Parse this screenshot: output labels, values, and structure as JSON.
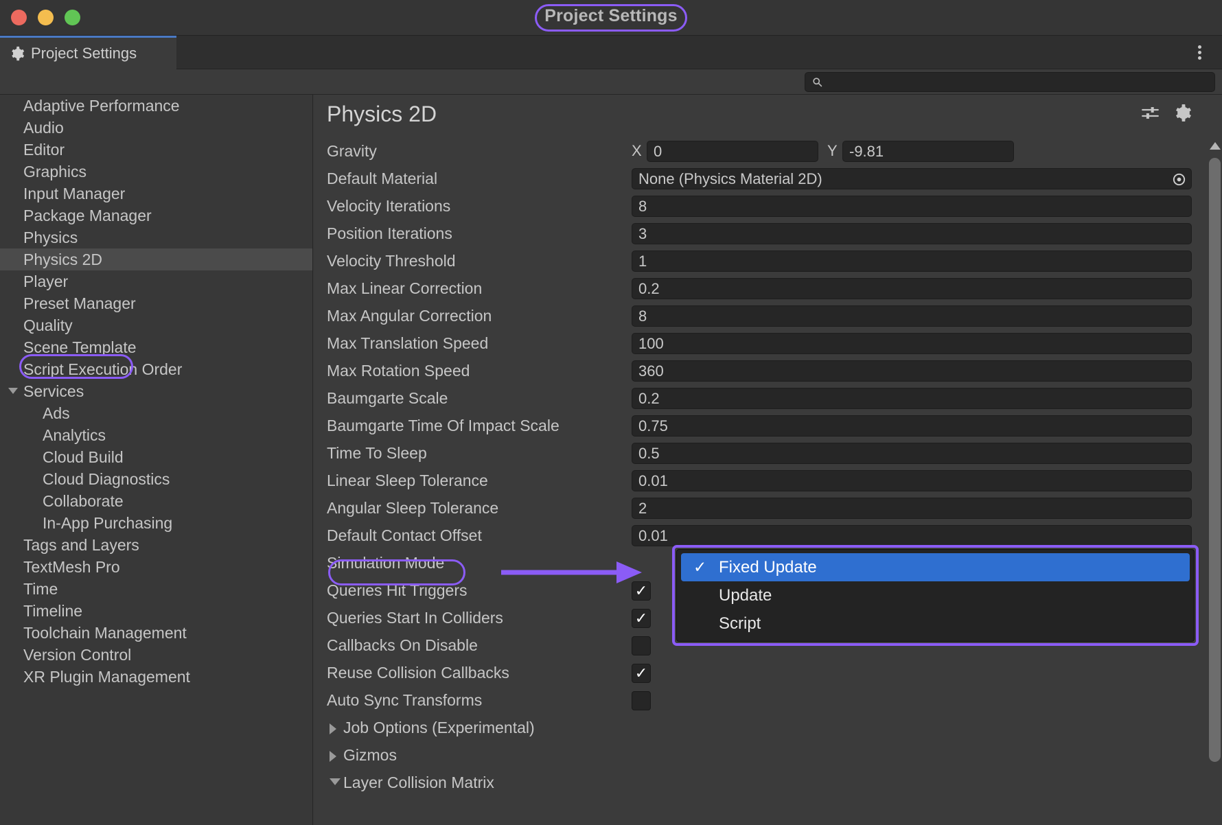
{
  "window": {
    "title": "Project Settings",
    "traffic_lights": [
      "close",
      "minimize",
      "maximize"
    ]
  },
  "tab": {
    "label": "Project Settings",
    "icon": "gear-icon"
  },
  "menu": {
    "kebab_icon": "kebab-menu-icon"
  },
  "search": {
    "value": "",
    "placeholder": "",
    "icon": "search-icon"
  },
  "sidebar": {
    "items": [
      {
        "label": "Adaptive Performance",
        "level": 0,
        "selected": false,
        "arrow": ""
      },
      {
        "label": "Audio",
        "level": 0,
        "selected": false,
        "arrow": ""
      },
      {
        "label": "Editor",
        "level": 0,
        "selected": false,
        "arrow": ""
      },
      {
        "label": "Graphics",
        "level": 0,
        "selected": false,
        "arrow": ""
      },
      {
        "label": "Input Manager",
        "level": 0,
        "selected": false,
        "arrow": ""
      },
      {
        "label": "Package Manager",
        "level": 0,
        "selected": false,
        "arrow": ""
      },
      {
        "label": "Physics",
        "level": 0,
        "selected": false,
        "arrow": ""
      },
      {
        "label": "Physics 2D",
        "level": 0,
        "selected": true,
        "arrow": ""
      },
      {
        "label": "Player",
        "level": 0,
        "selected": false,
        "arrow": ""
      },
      {
        "label": "Preset Manager",
        "level": 0,
        "selected": false,
        "arrow": ""
      },
      {
        "label": "Quality",
        "level": 0,
        "selected": false,
        "arrow": ""
      },
      {
        "label": "Scene Template",
        "level": 0,
        "selected": false,
        "arrow": ""
      },
      {
        "label": "Script Execution Order",
        "level": 0,
        "selected": false,
        "arrow": ""
      },
      {
        "label": "Services",
        "level": 0,
        "selected": false,
        "arrow": "down"
      },
      {
        "label": "Ads",
        "level": 1,
        "selected": false,
        "arrow": ""
      },
      {
        "label": "Analytics",
        "level": 1,
        "selected": false,
        "arrow": ""
      },
      {
        "label": "Cloud Build",
        "level": 1,
        "selected": false,
        "arrow": ""
      },
      {
        "label": "Cloud Diagnostics",
        "level": 1,
        "selected": false,
        "arrow": ""
      },
      {
        "label": "Collaborate",
        "level": 1,
        "selected": false,
        "arrow": ""
      },
      {
        "label": "In-App Purchasing",
        "level": 1,
        "selected": false,
        "arrow": ""
      },
      {
        "label": "Tags and Layers",
        "level": 0,
        "selected": false,
        "arrow": ""
      },
      {
        "label": "TextMesh Pro",
        "level": 0,
        "selected": false,
        "arrow": ""
      },
      {
        "label": "Time",
        "level": 0,
        "selected": false,
        "arrow": ""
      },
      {
        "label": "Timeline",
        "level": 0,
        "selected": false,
        "arrow": ""
      },
      {
        "label": "Toolchain Management",
        "level": 0,
        "selected": false,
        "arrow": ""
      },
      {
        "label": "Version Control",
        "level": 0,
        "selected": false,
        "arrow": ""
      },
      {
        "label": "XR Plugin Management",
        "level": 0,
        "selected": false,
        "arrow": ""
      }
    ]
  },
  "main": {
    "page_title": "Physics 2D",
    "header_icons": [
      "sliders-icon",
      "gear-icon"
    ],
    "gravity": {
      "label": "Gravity",
      "x_tag": "X",
      "x_value": "0",
      "y_tag": "Y",
      "y_value": "-9.81"
    },
    "rows": [
      {
        "label": "Default Material",
        "value": "None (Physics Material 2D)",
        "type": "object",
        "picker_icon": "object-picker-icon"
      },
      {
        "label": "Velocity Iterations",
        "value": "8",
        "type": "text"
      },
      {
        "label": "Position Iterations",
        "value": "3",
        "type": "text"
      },
      {
        "label": "Velocity Threshold",
        "value": "1",
        "type": "text"
      },
      {
        "label": "Max Linear Correction",
        "value": "0.2",
        "type": "text"
      },
      {
        "label": "Max Angular Correction",
        "value": "8",
        "type": "text"
      },
      {
        "label": "Max Translation Speed",
        "value": "100",
        "type": "text"
      },
      {
        "label": "Max Rotation Speed",
        "value": "360",
        "type": "text"
      },
      {
        "label": "Baumgarte Scale",
        "value": "0.2",
        "type": "text"
      },
      {
        "label": "Baumgarte Time Of Impact Scale",
        "value": "0.75",
        "type": "text"
      },
      {
        "label": "Time To Sleep",
        "value": "0.5",
        "type": "text"
      },
      {
        "label": "Linear Sleep Tolerance",
        "value": "0.01",
        "type": "text"
      },
      {
        "label": "Angular Sleep Tolerance",
        "value": "2",
        "type": "text"
      },
      {
        "label": "Default Contact Offset",
        "value": "0.01",
        "type": "text"
      },
      {
        "label": "Simulation Mode",
        "value": "Fixed Update",
        "type": "dropdown"
      },
      {
        "label": "Queries Hit Triggers",
        "value": "",
        "type": "checkbox",
        "checked": true
      },
      {
        "label": "Queries Start In Colliders",
        "value": "",
        "type": "checkbox",
        "checked": true
      },
      {
        "label": "Callbacks On Disable",
        "value": "",
        "type": "checkbox",
        "checked": false
      },
      {
        "label": "Reuse Collision Callbacks",
        "value": "✓",
        "type": "checkbox",
        "checked": true
      },
      {
        "label": "Auto Sync Transforms",
        "value": "",
        "type": "checkbox",
        "checked": false
      }
    ],
    "foldouts": [
      {
        "label": "Job Options (Experimental)",
        "expanded": false
      },
      {
        "label": "Gizmos",
        "expanded": false
      },
      {
        "label": "Layer Collision Matrix",
        "expanded": true
      }
    ]
  },
  "dropdown": {
    "open": true,
    "items": [
      {
        "label": "Fixed Update",
        "selected": true,
        "check": "✓"
      },
      {
        "label": "Update",
        "selected": false,
        "check": ""
      },
      {
        "label": "Script",
        "selected": false,
        "check": ""
      }
    ]
  },
  "annotations": {
    "color": "#8b5cf6",
    "targets": [
      "window-title",
      "sidebar-physics-2d",
      "simulation-mode-label",
      "simulation-mode-dropdown"
    ],
    "arrow": "points from Simulation Mode label to the open dropdown"
  },
  "scrollbar": {
    "up_arrow_icon": "scroll-up-arrow-icon"
  }
}
